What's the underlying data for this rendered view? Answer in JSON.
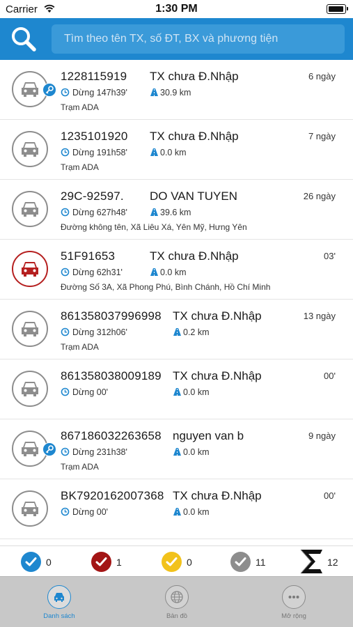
{
  "status_bar": {
    "carrier": "Carrier",
    "time": "1:30 PM"
  },
  "search": {
    "placeholder": "Tìm theo tên TX, số ĐT, BX và phương tiện"
  },
  "colors": {
    "primary": "#1e87cf",
    "red": "#b51f1f",
    "gray": "#8d8d8d",
    "yellow": "#f2c21b",
    "dark_red": "#a31515"
  },
  "vehicles": [
    {
      "plate": "1228115919",
      "driver": "TX chưa Đ.Nhập",
      "ago": "6 ngày",
      "stop": "Dừng 147h39'",
      "distance": "30.9 km",
      "address": "Trạm ADA",
      "status": "gray",
      "has_key": true
    },
    {
      "plate": "1235101920",
      "driver": "TX chưa Đ.Nhập",
      "ago": "7 ngày",
      "stop": "Dừng 191h58'",
      "distance": "0.0 km",
      "address": "Trạm ADA",
      "status": "gray",
      "has_key": false
    },
    {
      "plate": "29C-92597.",
      "driver": "DO VAN TUYEN",
      "ago": "26 ngày",
      "stop": "Dừng 627h48'",
      "distance": "39.6 km",
      "address": "Đường không tên, Xã Liêu Xá, Yên Mỹ, Hưng Yên",
      "status": "gray",
      "has_key": false
    },
    {
      "plate": "51F91653",
      "driver": "TX chưa Đ.Nhập",
      "ago": "03'",
      "stop": "Dừng 62h31'",
      "distance": "0.0 km",
      "address": "Đường Số 3A, Xã Phong Phú, Bình Chánh, Hồ Chí Minh",
      "status": "red",
      "has_key": false
    },
    {
      "plate": "861358037996998",
      "driver": "TX chưa Đ.Nhập",
      "ago": "13 ngày",
      "stop": "Dừng 312h06'",
      "distance": "0.2 km",
      "address": "Trạm ADA",
      "status": "gray",
      "has_key": false
    },
    {
      "plate": "861358038009189",
      "driver": "TX chưa Đ.Nhập",
      "ago": "00'",
      "stop": "Dừng 00'",
      "distance": "0.0 km",
      "address": "",
      "status": "gray",
      "has_key": false
    },
    {
      "plate": "867186032263658",
      "driver": "nguyen van b",
      "ago": "9 ngày",
      "stop": "Dừng 231h38'",
      "distance": "0.0 km",
      "address": "Trạm ADA",
      "status": "gray",
      "has_key": true
    },
    {
      "plate": "BK7920162007368",
      "driver": "TX chưa Đ.Nhập",
      "ago": "00'",
      "stop": "Dừng 00'",
      "distance": "0.0 km",
      "address": "",
      "status": "gray",
      "has_key": false
    }
  ],
  "summary": {
    "blue_count": "0",
    "red_count": "1",
    "yellow_count": "0",
    "gray_count": "11",
    "total_count": "12"
  },
  "tabs": [
    {
      "label": "Danh sách",
      "icon": "car-icon",
      "active": true
    },
    {
      "label": "Bản đồ",
      "icon": "globe-icon",
      "active": false
    },
    {
      "label": "Mở rộng",
      "icon": "more-icon",
      "active": false
    }
  ]
}
